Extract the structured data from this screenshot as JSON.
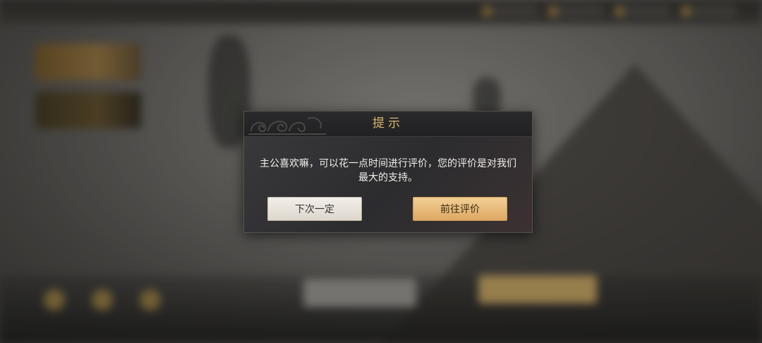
{
  "dialog": {
    "title": "提示",
    "message": "主公喜欢嘛，可以花一点时间进行评价，您的评价是对我们最大的支持。",
    "buttons": {
      "later_label": "下次一定",
      "review_label": "前往评价"
    }
  },
  "icons": {
    "header_ornament": "cloud-pattern-ornament"
  },
  "colors": {
    "title_gold": "#d7b56d",
    "dialog_bg": "#2f2f32",
    "later_button_bg": "#e9e3db",
    "review_button_bg": "#e8bb7c"
  }
}
